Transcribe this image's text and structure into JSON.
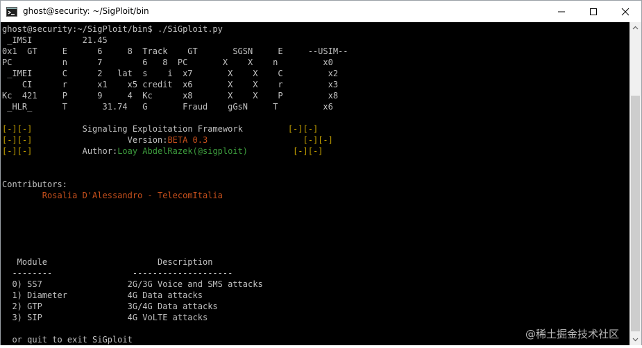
{
  "window": {
    "title": "ghost@security: ~/SigPloit/bin",
    "controls": {
      "minimize_icon": "minimize-icon",
      "maximize_icon": "maximize-icon",
      "close_icon": "close-icon"
    }
  },
  "terminal": {
    "prompt": "ghost@security:~/SigPloit/bin$ ./SiGploit.py",
    "banner": [
      " _IMSI          21.45",
      "0x1  GT     E      6     8  Track    GT       SGSN     E     --USIM--",
      "PC          n      7        6   8  PC       X    X    n         x0",
      " _IMEI      C      2   lat  s    i  x7       X    X    C         x2",
      "    CI      r      x1    x5 credit  x6       X    X    r         x3",
      "Kc  421     P      9     4  Kc      x8       X    X    P         x8",
      " _HLR_      T       31.74   G       Fraud    gGsN     T         x6"
    ],
    "frame": {
      "tag": "[-][-]",
      "title": "Signaling Exploitation Framework",
      "version_label": "Version:",
      "version_value": "BETA 0.3",
      "author_label": "Author:",
      "author_value": "Loay AbdelRazek(@sigploit)"
    },
    "contributors_label": "Contributors:",
    "contributor": "Rosalia D'Alessandro - TelecomItalia",
    "module_header": "   Module                      Description",
    "module_rule": "  --------                --------------------",
    "modules": [
      "  0) SS7                 2G/3G Voice and SMS attacks",
      "  1) Diameter            4G Data attacks",
      "  2) GTP                 3G/4G Data attacks",
      "  3) SIP                 4G VoLTE attacks"
    ],
    "quit_hint": "  or quit to exit SiGploit"
  },
  "watermark": "@稀土掘金技术社区",
  "colors": {
    "background": "#000000",
    "text": "#c0c0c0",
    "tag": "#c4a000",
    "version": "#c7501c",
    "author": "#3c9a3c",
    "contributor": "#c7501c"
  }
}
